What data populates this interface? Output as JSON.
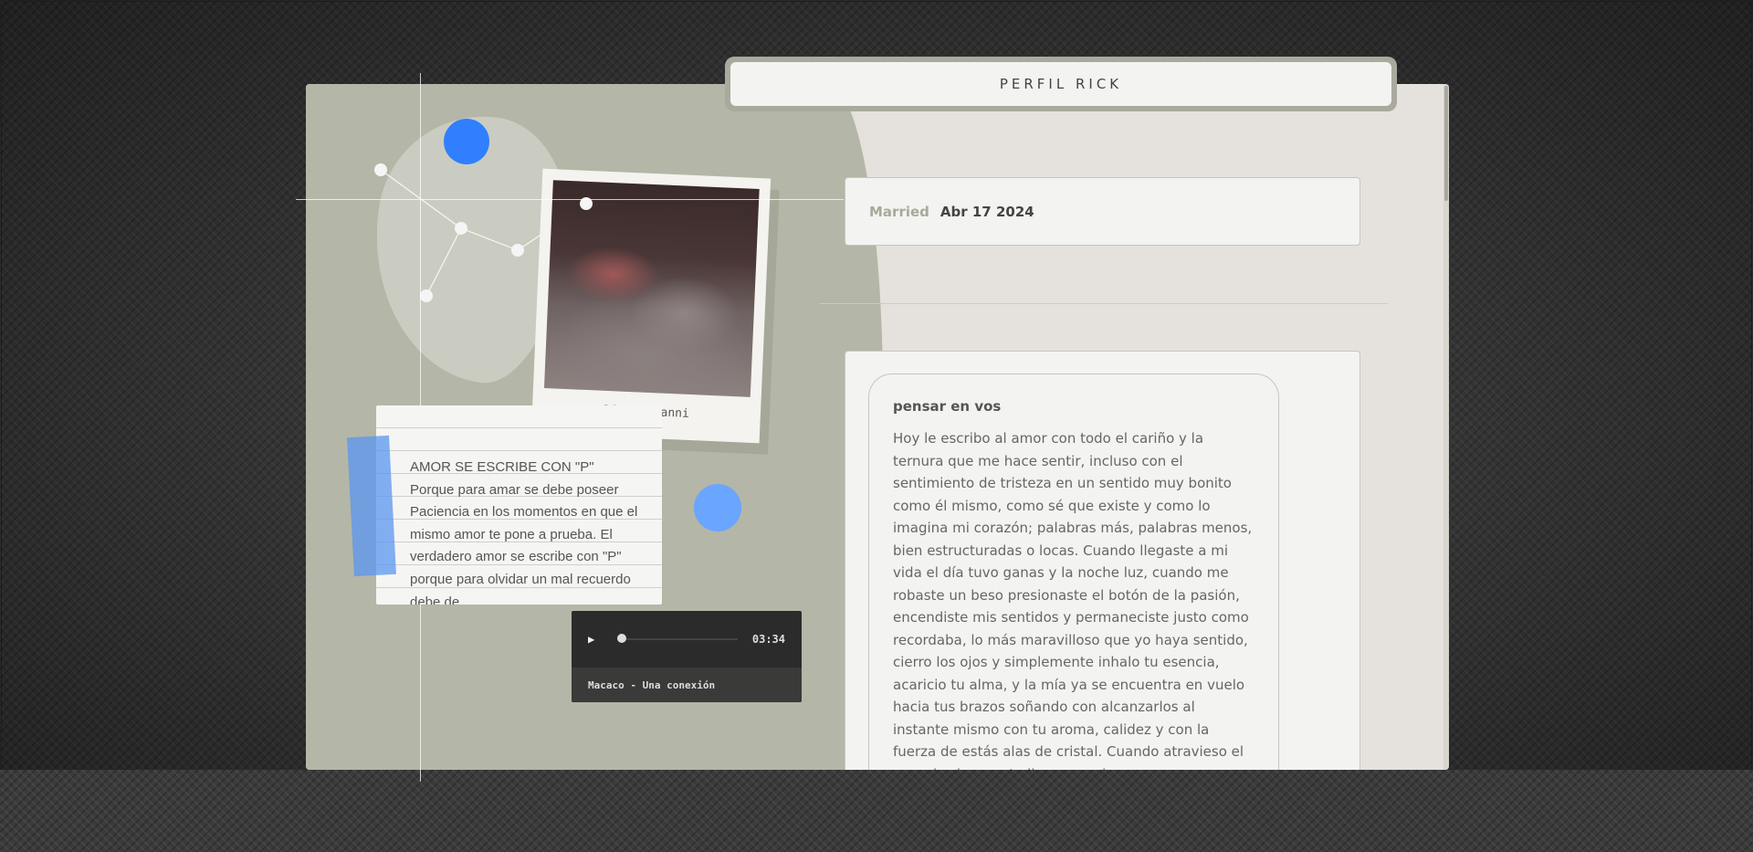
{
  "header": {
    "title": "PERFIL RICK"
  },
  "status": {
    "label": "Married",
    "date": "Abr 17 2024"
  },
  "polaroid": {
    "caption": "Rick & Hanni"
  },
  "note": {
    "text": "AMOR SE ESCRIBE CON \"P\" Porque para amar se debe poseer Paciencia en los momentos en que el mismo amor te pone a prueba. El verdadero amor se escribe con \"P\" porque para olvidar un mal recuerdo debe de"
  },
  "player": {
    "time": "03:34",
    "track": "Macaco - Una conexión",
    "progress": 0,
    "play_icon": "▶"
  },
  "letter": {
    "title": "pensar en vos",
    "body": "Hoy le escribo al amor con todo el cariño y la ternura que me hace sentir, incluso con el sentimiento de tristeza en un sentido muy bonito como él mismo, como sé que existe y como lo imagina mi corazón; palabras más, palabras menos, bien estructuradas o locas. Cuando llegaste a mi vida el día tuvo ganas y la noche luz, cuando me robaste un beso presionaste el botón de la pasión, encendiste mis sentidos y permaneciste justo como recordaba, lo más maravilloso que yo haya sentido, cierro los ojos y simplemente inhalo tu esencia, acaricio tu alma, y la mía ya se encuentra en vuelo hacia tus brazos soñando con alcanzarlos al instante mismo con tu aroma, calidez y con la fuerza de estás alas de cristal. Cuando atravieso el espacio siempre te llevo conmigo,"
  },
  "colors": {
    "accent_blue": "#2f7fff",
    "accent_blue_light": "#6aa5ff",
    "sage": "#b4b6a7"
  }
}
